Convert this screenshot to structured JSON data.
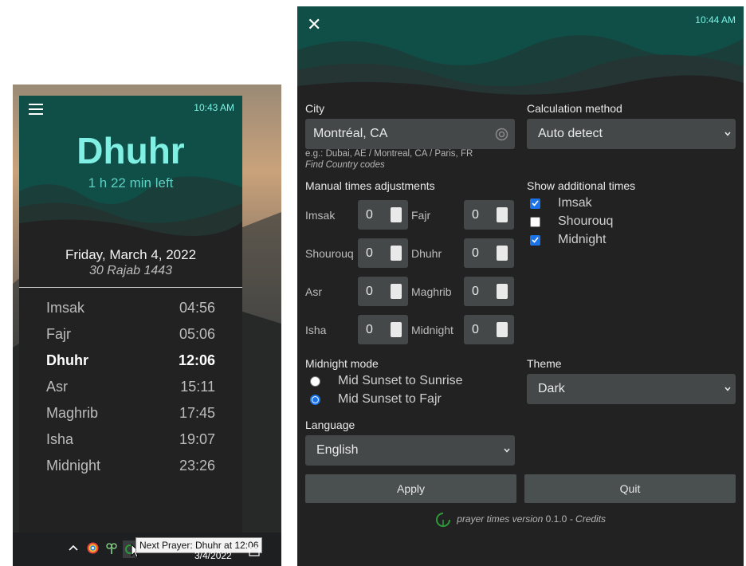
{
  "widget": {
    "time": "10:43 AM",
    "next_prayer": "Dhuhr",
    "time_left": "1 h 22 min left",
    "date_gregorian": "Friday, March 4, 2022",
    "date_hijri": "30 Rajab 1443",
    "prayers": [
      {
        "name": "Imsak",
        "time": "04:56"
      },
      {
        "name": "Fajr",
        "time": "05:06"
      },
      {
        "name": "Dhuhr",
        "time": "12:06",
        "active": true
      },
      {
        "name": "Asr",
        "time": "15:11"
      },
      {
        "name": "Maghrib",
        "time": "17:45"
      },
      {
        "name": "Isha",
        "time": "19:07"
      },
      {
        "name": "Midnight",
        "time": "23:26"
      }
    ]
  },
  "taskbar": {
    "tooltip": "Next Prayer: Dhuhr at 12:06",
    "date": "3/4/2022",
    "icons": [
      "chevron-up-icon",
      "colorful-app-icon",
      "plant-icon",
      "prayer-times-tray-icon"
    ]
  },
  "settings": {
    "time": "10:44 AM",
    "close_glyph": "✕",
    "city_label": "City",
    "city_value": "Montréal, CA",
    "city_hint": "e.g.: Dubai, AE / Montreal, CA / Paris, FR",
    "city_link": "Find Country codes",
    "calc_label": "Calculation method",
    "calc_value": "Auto detect",
    "manual_label": "Manual times adjustments",
    "adjustments": [
      {
        "name": "Imsak",
        "value": "0"
      },
      {
        "name": "Fajr",
        "value": "0"
      },
      {
        "name": "Shourouq",
        "value": "0"
      },
      {
        "name": "Dhuhr",
        "value": "0"
      },
      {
        "name": "Asr",
        "value": "0"
      },
      {
        "name": "Maghrib",
        "value": "0"
      },
      {
        "name": "Isha",
        "value": "0"
      },
      {
        "name": "Midnight",
        "value": "0"
      }
    ],
    "additional_label": "Show additional times",
    "additional": [
      {
        "name": "Imsak",
        "checked": true
      },
      {
        "name": "Shourouq",
        "checked": false
      },
      {
        "name": "Midnight",
        "checked": true
      }
    ],
    "midnight_label": "Midnight mode",
    "midnight_options": [
      {
        "name": "Mid Sunset to Sunrise",
        "selected": false
      },
      {
        "name": "Mid Sunset to Fajr",
        "selected": true
      }
    ],
    "theme_label": "Theme",
    "theme_value": "Dark",
    "language_label": "Language",
    "language_value": "English",
    "apply_label": "Apply",
    "quit_label": "Quit",
    "footer_app": "prayer times version",
    "footer_version": "0.1.0",
    "footer_sep": "-",
    "footer_credits": "Credits"
  },
  "colors": {
    "accent": "#7ff0e3",
    "panel": "#222222",
    "teal": "#0d4d45",
    "checkbox": "#1a73e8"
  }
}
